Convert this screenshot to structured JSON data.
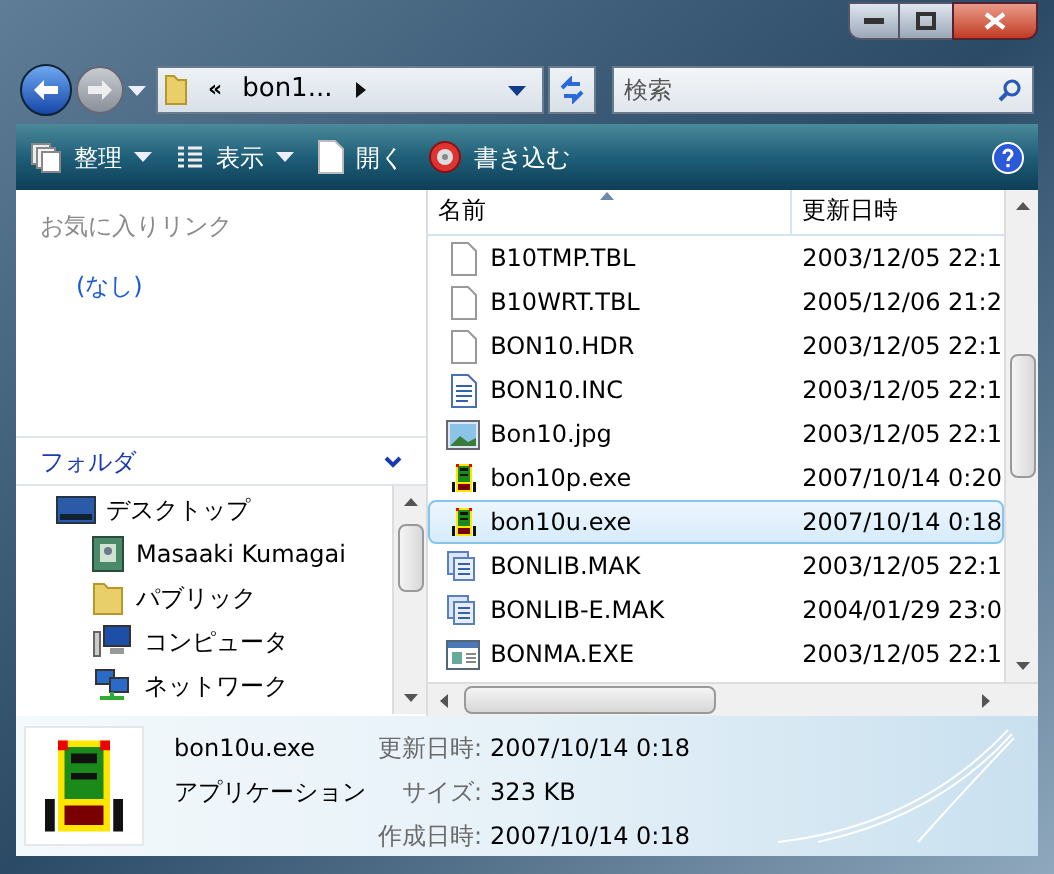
{
  "navigation": {
    "breadcrumb_prefix": "«",
    "path": "bon1...",
    "search": {
      "placeholder": "検索"
    }
  },
  "toolbar": [
    {
      "label": "整理",
      "kind": "stack",
      "dropdown": true
    },
    {
      "label": "表示",
      "kind": "list",
      "dropdown": true
    },
    {
      "label": "開く",
      "kind": "page",
      "dropdown": false
    },
    {
      "label": "書き込む",
      "kind": "disc",
      "dropdown": false
    }
  ],
  "favorites": {
    "title": "お気に入りリンク",
    "items": [
      "(なし)"
    ]
  },
  "folders": {
    "title": "フォルダ",
    "tree": [
      {
        "label": "デスクトップ",
        "kind": "desktop",
        "children": [
          {
            "label": "Masaaki Kumagai",
            "kind": "user"
          },
          {
            "label": "パブリック",
            "kind": "folder"
          },
          {
            "label": "コンピュータ",
            "kind": "computer"
          },
          {
            "label": "ネットワーク",
            "kind": "network"
          }
        ]
      }
    ]
  },
  "file_list": {
    "columns": [
      "名前",
      "更新日時"
    ],
    "rows": [
      {
        "name": "B10TMP.TBL",
        "modified": "2003/12/05 22:1",
        "kind": "blank",
        "selected": false
      },
      {
        "name": "B10WRT.TBL",
        "modified": "2005/12/06 21:2",
        "kind": "blank",
        "selected": false
      },
      {
        "name": "BON10.HDR",
        "modified": "2003/12/05 22:1",
        "kind": "blank",
        "selected": false
      },
      {
        "name": "BON10.INC",
        "modified": "2003/12/05 22:1",
        "kind": "text",
        "selected": false
      },
      {
        "name": "Bon10.jpg",
        "modified": "2003/12/05 22:1",
        "kind": "image",
        "selected": false
      },
      {
        "name": "bon10p.exe",
        "modified": "2007/10/14 0:20",
        "kind": "robot",
        "selected": false
      },
      {
        "name": "bon10u.exe",
        "modified": "2007/10/14 0:18",
        "kind": "robot",
        "selected": true
      },
      {
        "name": "BONLIB.MAK",
        "modified": "2003/12/05 22:1",
        "kind": "make",
        "selected": false
      },
      {
        "name": "BONLIB-E.MAK",
        "modified": "2004/01/29 23:0",
        "kind": "make",
        "selected": false
      },
      {
        "name": "BONMA.EXE",
        "modified": "2003/12/05 22:1",
        "kind": "window",
        "selected": false
      }
    ]
  },
  "details": {
    "name": "bon10u.exe",
    "type": "アプリケーション",
    "fields": [
      {
        "label": "更新日時:",
        "value": "2007/10/14 0:18"
      },
      {
        "label": "サイズ:",
        "value": "323 KB"
      },
      {
        "label": "作成日時:",
        "value": "2007/10/14 0:18"
      }
    ]
  }
}
